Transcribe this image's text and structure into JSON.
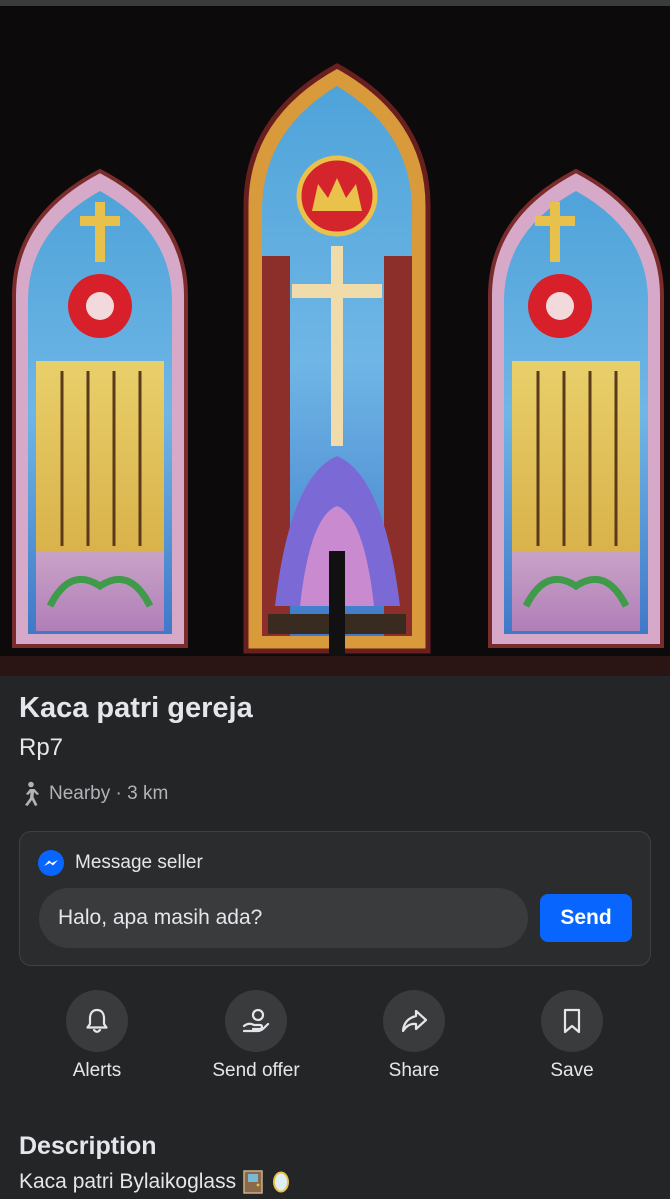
{
  "listing": {
    "title": "Kaca patri gereja",
    "price": "Rp7",
    "location": "Nearby · 3 km"
  },
  "message": {
    "header": "Message seller",
    "input_value": "Halo, apa masih ada?",
    "send_label": "Send"
  },
  "actions": [
    {
      "label": "Alerts",
      "icon": "bell-icon"
    },
    {
      "label": "Send offer",
      "icon": "offer-icon"
    },
    {
      "label": "Share",
      "icon": "share-icon"
    },
    {
      "label": "Save",
      "icon": "bookmark-icon"
    }
  ],
  "description": {
    "heading": "Description",
    "text": "Kaca patri Bylaikoglass"
  },
  "colors": {
    "background": "#242526",
    "accent": "#0866ff",
    "muted_text": "#b0b3b8"
  }
}
